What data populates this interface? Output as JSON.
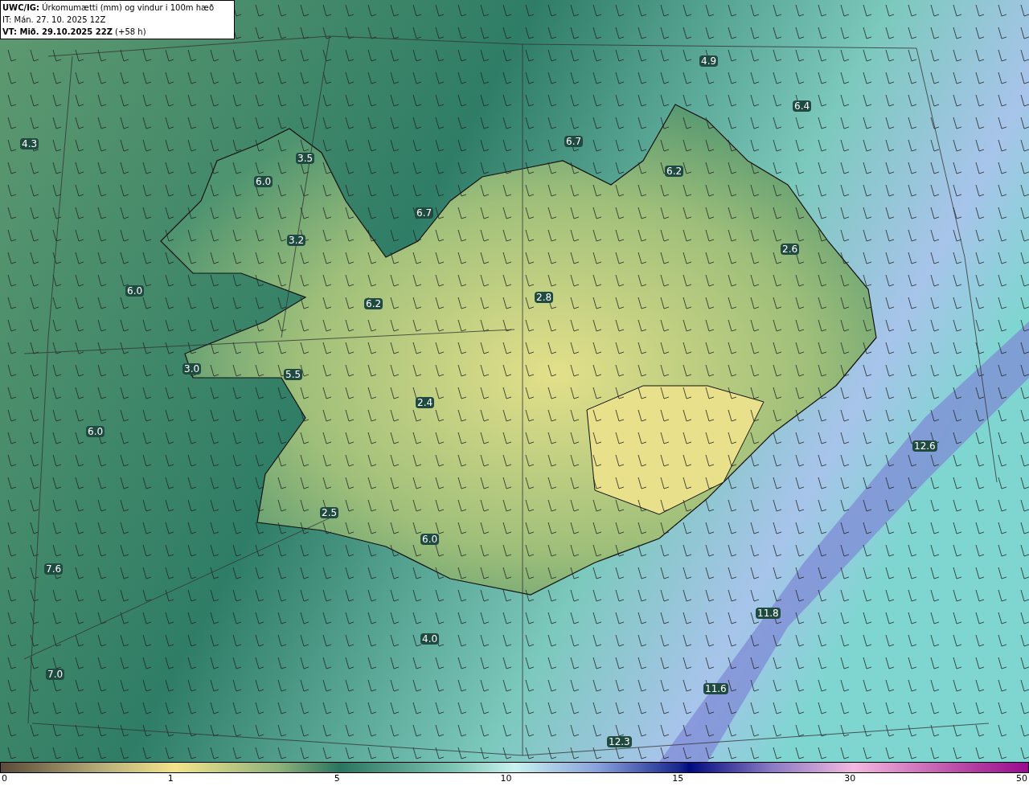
{
  "header": {
    "title": "**UWC/IG:** Úrkomumætti (mm) og vindur i 100m hæð",
    "initial_time": "IT: Mán. 27. 10. 2025 12Z",
    "valid_time": "**VT: Mið. 29.10.2025 22Z** (+58 h)"
  },
  "map_labels": [
    "4.9",
    "6.4",
    "4.3",
    "6.7",
    "3.5",
    "6.2",
    "6.0",
    "6.7",
    "3.2",
    "2.6",
    "6.0",
    "2.8",
    "6.2",
    "3.0",
    "5.5",
    "2.4",
    "12.6",
    "6.0",
    "2.5",
    "6.0",
    "7.6",
    "11.8",
    "4.0",
    "7.0",
    "11.6",
    "12.3"
  ],
  "color_scale": {
    "ticks": [
      "0",
      "1",
      "5",
      "10",
      "15",
      "30",
      "50"
    ]
  }
}
